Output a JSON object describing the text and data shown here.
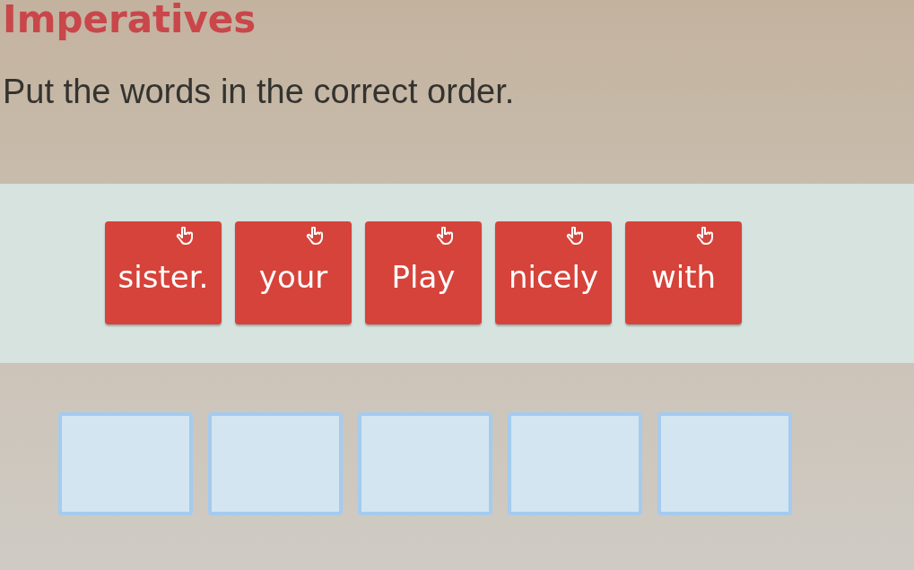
{
  "title": "Imperatives",
  "instruction": "Put the words in the correct order.",
  "word_tiles": [
    {
      "text": "sister."
    },
    {
      "text": "your"
    },
    {
      "text": "Play"
    },
    {
      "text": "nicely"
    },
    {
      "text": "with"
    }
  ],
  "answer_boxes": [
    {
      "filled": false
    },
    {
      "filled": false
    },
    {
      "filled": false
    },
    {
      "filled": false
    },
    {
      "filled": false
    }
  ]
}
